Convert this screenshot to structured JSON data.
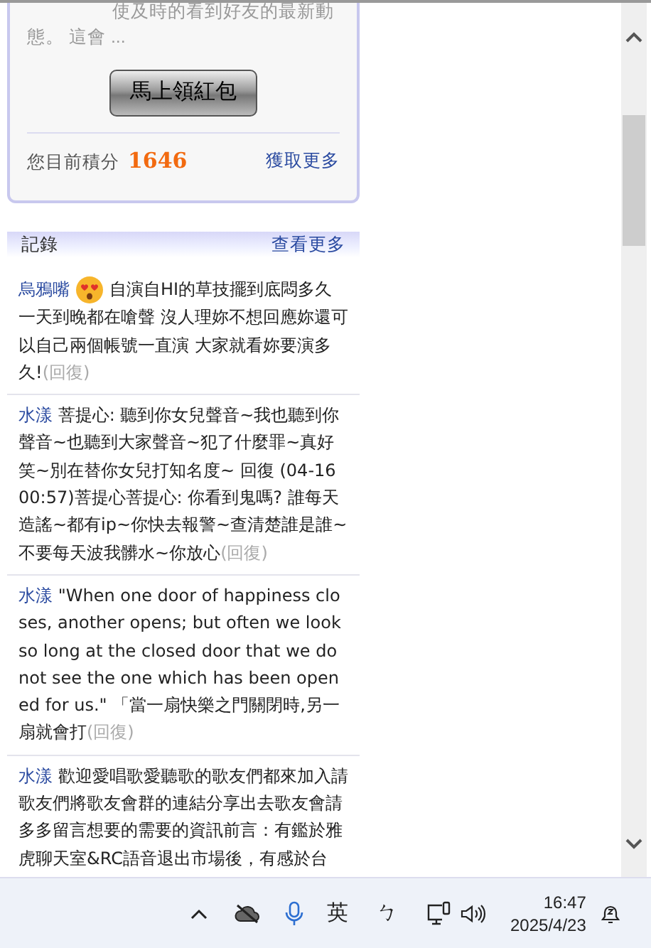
{
  "promo_card": {
    "description_line_1": "使及時的看到好友的最新動",
    "description_line_2": "態。 這會 ...",
    "button": "馬上領紅包",
    "points_label": "您目前積分",
    "points_value": "1646",
    "more_link": "獲取更多"
  },
  "records": {
    "title": "記錄",
    "more_link": "查看更多",
    "entries": [
      {
        "name": "烏鴉嘴",
        "emoji": true,
        "text": "自演自HI的草技擺到底悶多久一天到晚都在嗆聲 沒人理妳不想回應妳還可以自己兩個帳號一直演 大家就看妳要演多久!",
        "reply": "(回復)"
      },
      {
        "name": "水漾",
        "emoji": false,
        "text": "菩提心: 聽到你女兒聲音~我也聽到你聲音~也聽到大家聲音~犯了什麼罪~真好笑~別在替你女兒打知名度~ 回復 (04-16 00:57)菩提心菩提心: 你看到鬼嗎? 誰每天造謠~都有ip~你快去報警~查清楚誰是誰~不要每天波我髒水~你放心",
        "reply": "(回復)"
      },
      {
        "name": "水漾",
        "emoji": false,
        "text": "\"When one door of happiness closes, another opens; but often we look so long at the closed door that we do not see the one which has been opened for us.\" 「當一扇快樂之門關閉時,另一扇就會打",
        "reply": "(回復)"
      },
      {
        "name": "水漾",
        "emoji": false,
        "text": "歡迎愛唱歌愛聽歌的歌友們都來加入請歌友們將歌友會群的連結分享出去歌友會請多多留言想要的需要的資訊前言：有鑑於雅虎聊天室&RC語音退出市場後，有感於台"
      }
    ]
  },
  "taskbar": {
    "ime_mode": "英",
    "ime_layout": "ㄅ",
    "time": "16:47",
    "date": "2025/4/23"
  }
}
